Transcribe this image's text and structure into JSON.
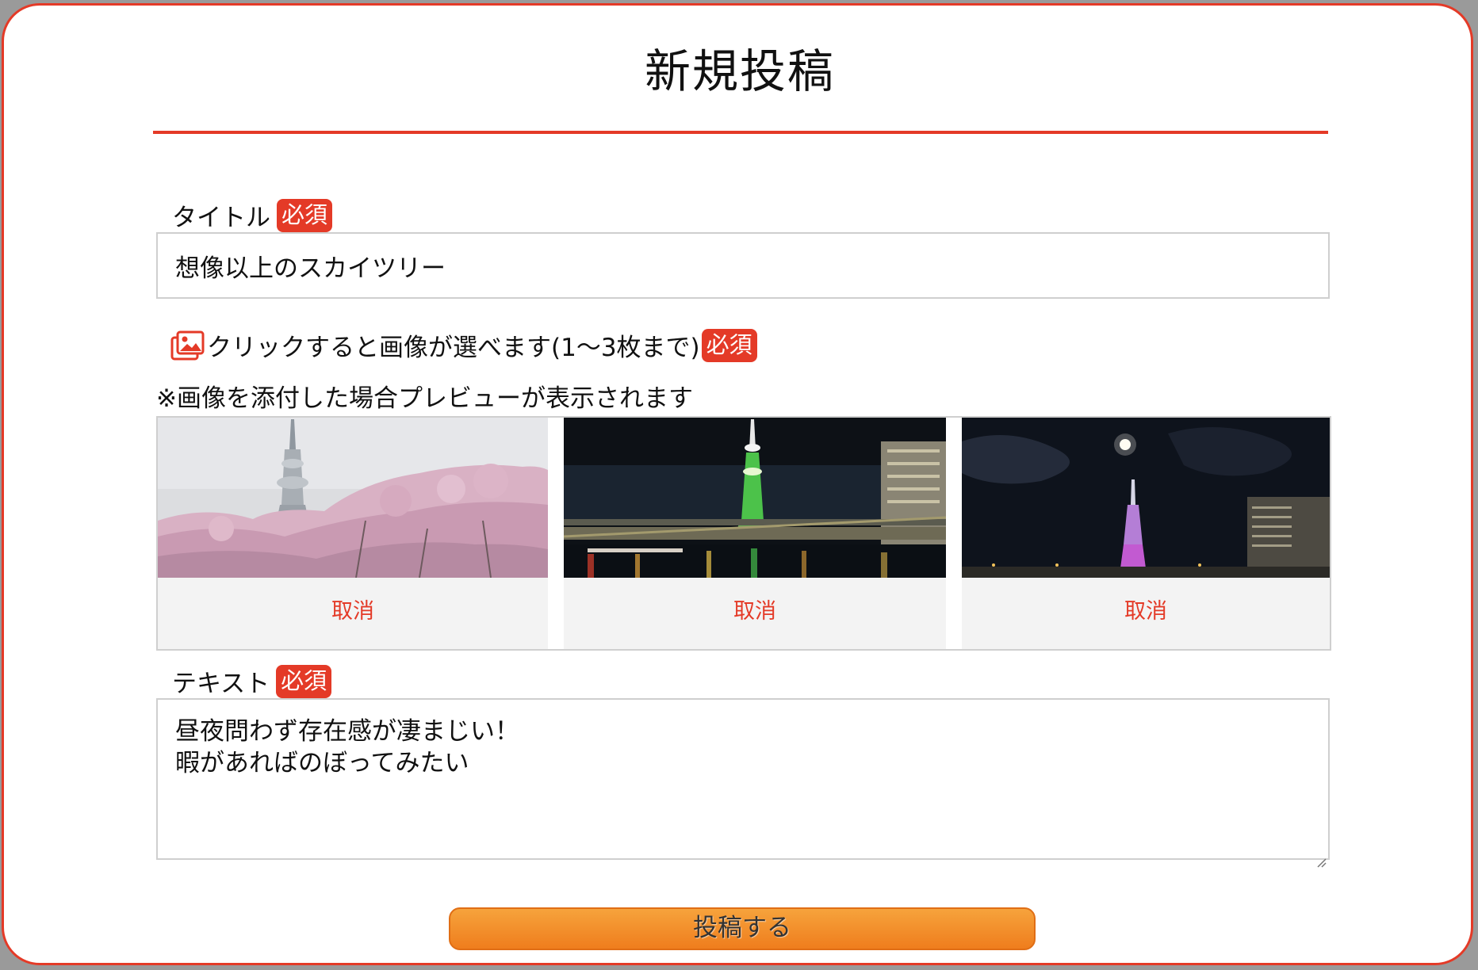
{
  "page": {
    "title": "新規投稿"
  },
  "title_field": {
    "label": "タイトル",
    "required_badge": "必須",
    "value": "想像以上のスカイツリー"
  },
  "image_field": {
    "label": "クリックすると画像が選べます(1〜3枚まで)",
    "required_badge": "必須",
    "icon": "image-upload-icon",
    "note": "※画像を添付した場合プレビューが表示されます",
    "previews": [
      {
        "photo": "skytree-cherry-blossoms",
        "cancel_label": "取消"
      },
      {
        "photo": "skytree-green-night-river",
        "cancel_label": "取消"
      },
      {
        "photo": "skytree-purple-moon-night",
        "cancel_label": "取消"
      }
    ]
  },
  "text_field": {
    "label": "テキスト",
    "required_badge": "必須",
    "lines": [
      "昼夜問わず存在感が凄まじい！",
      "暇があればのぼってみたい"
    ]
  },
  "submit": {
    "label": "投稿する"
  },
  "colors": {
    "accent": "#e43a27",
    "button": "#f28c28"
  }
}
